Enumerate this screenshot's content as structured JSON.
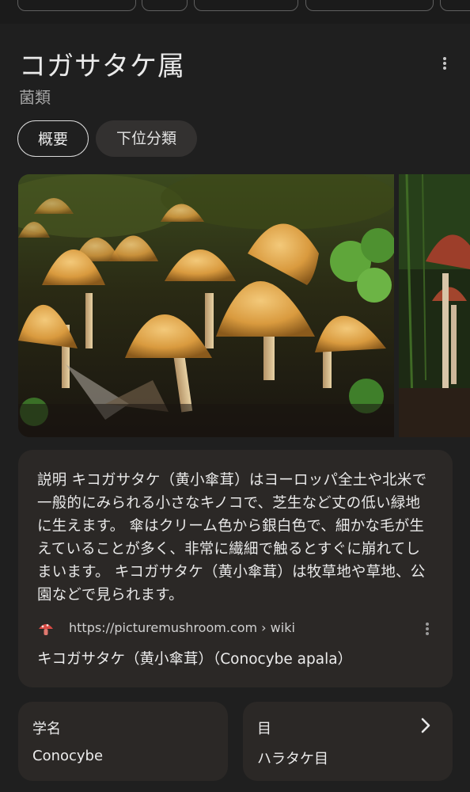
{
  "header": {
    "title": "コガサタケ属",
    "subtitle": "菌類"
  },
  "tabs": [
    {
      "label": "概要",
      "selected": true
    },
    {
      "label": "下位分類",
      "selected": false
    }
  ],
  "description": {
    "text": "説明 キコガサタケ（黄小傘茸）はヨーロッパ全土や北米で一般的にみられる小さなキノコで、芝生など丈の低い緑地に生えます。 傘はクリーム色から銀白色で、細かな毛が生えていることが多く、非常に繊細で触るとすぐに崩れてしまいます。 キコガサタケ（黄小傘茸）は牧草地や草地、公園などで見られます。",
    "source_url": "https://picturemushroom.com › wiki",
    "source_title": "キコガサタケ（黄小傘茸）（Conocybe apala）",
    "source_icon": "mushroom-icon"
  },
  "info_cards": [
    {
      "label": "学名",
      "value": "Conocybe"
    },
    {
      "label": "目",
      "value": "ハラタケ目",
      "icon": "chevron-right-icon"
    }
  ],
  "colors": {
    "background": "#1f1f1f",
    "card": "#2b2826",
    "text": "#e3e3e3",
    "secondary_text": "#a5a5a5"
  }
}
